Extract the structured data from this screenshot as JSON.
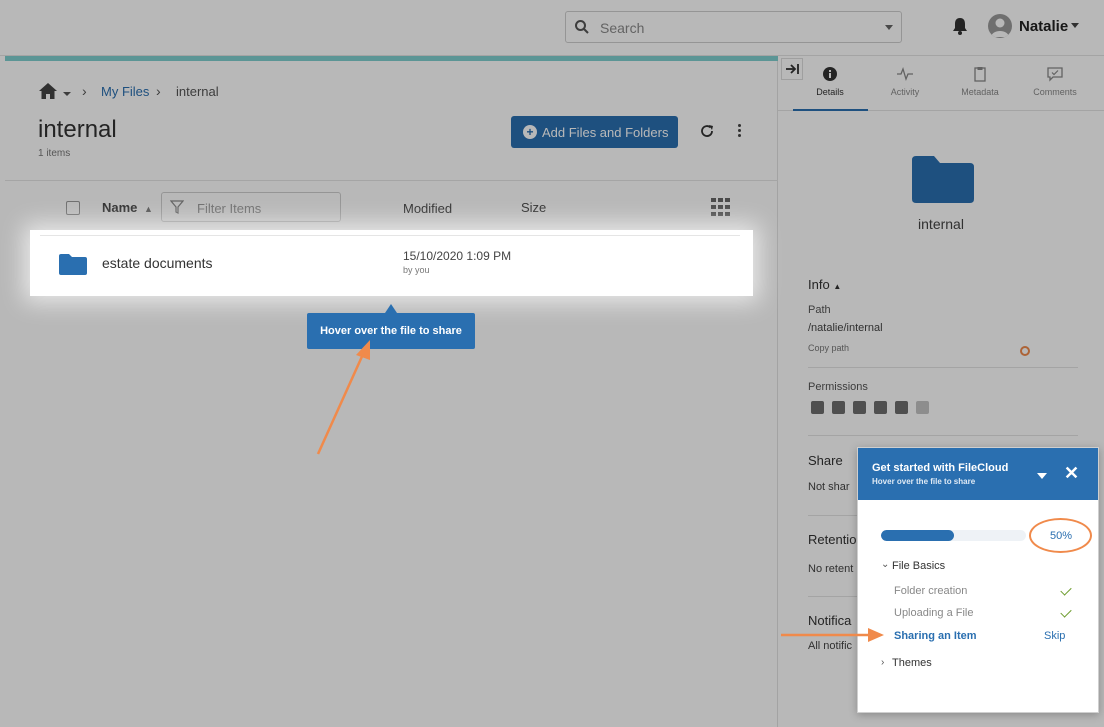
{
  "topbar": {
    "search_placeholder": "Search",
    "username": "Natalie"
  },
  "breadcrumb": {
    "items": [
      "My Files",
      "internal"
    ]
  },
  "folder": {
    "title": "internal",
    "item_count": "1 items"
  },
  "toolbar": {
    "add_label": "Add Files and Folders"
  },
  "list": {
    "headers": {
      "name": "Name",
      "modified": "Modified",
      "size": "Size"
    },
    "filter_placeholder": "Filter Items",
    "rows": [
      {
        "name": "estate documents",
        "modified": "15/10/2020 1:09 PM",
        "by": "by you"
      }
    ]
  },
  "tooltip": {
    "text": "Hover over the file to share"
  },
  "details_panel": {
    "tabs": [
      "Details",
      "Activity",
      "Metadata",
      "Comments"
    ],
    "folder_name": "internal",
    "info_title": "Info",
    "path_label": "Path",
    "path_value": "/natalie/internal",
    "copy_path": "Copy path",
    "permissions_label": "Permissions",
    "share_title": "Share",
    "share_text": "Not shar",
    "retention_title": "Retentio",
    "retention_text": "No retent",
    "notif_title": "Notifica",
    "notif_text": "All notific"
  },
  "get_started": {
    "title": "Get started with FileCloud",
    "subtitle": "Hover over the file to share",
    "progress": 0.5,
    "progress_label": "50%",
    "section": "File Basics",
    "steps": [
      {
        "label": "Folder creation",
        "done": true
      },
      {
        "label": "Uploading a File",
        "done": true
      },
      {
        "label": "Sharing an Item",
        "done": false,
        "action": "Skip"
      }
    ],
    "next_section": "Themes"
  },
  "colors": {
    "accent": "#2a6fb0",
    "annotation": "#f08a4b",
    "teal": "#7ecfcf",
    "check": "#6b9b2a"
  }
}
